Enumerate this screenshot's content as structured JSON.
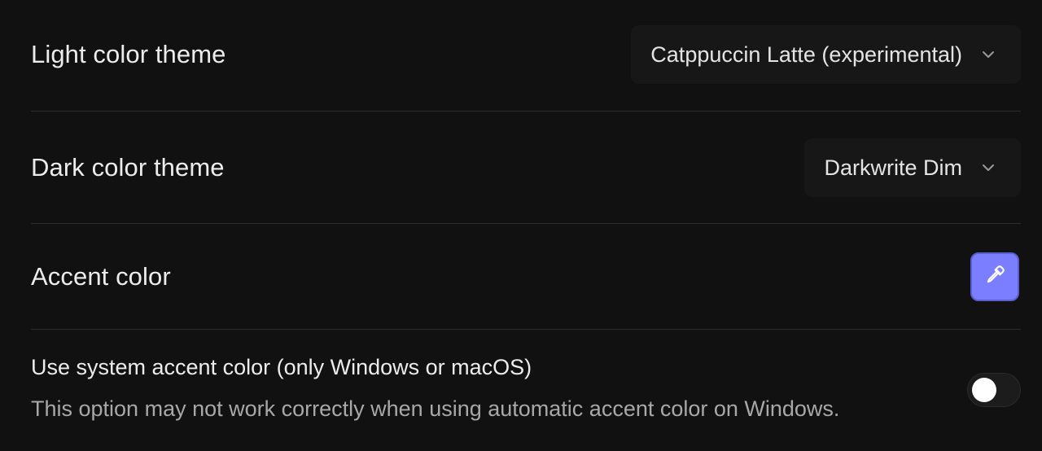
{
  "light_theme": {
    "label": "Light color theme",
    "selected": "Catppuccin Latte (experimental)"
  },
  "dark_theme": {
    "label": "Dark color theme",
    "selected": "Darkwrite Dim"
  },
  "accent": {
    "label": "Accent color",
    "color": "#7b7fff",
    "icon": "eyedropper-icon"
  },
  "system_accent": {
    "title": "Use system accent color (only Windows or macOS)",
    "description": "This option may not work correctly when using automatic accent color on Windows.",
    "enabled": false
  },
  "colors": {
    "background": "#111111",
    "divider": "#2c2c2c",
    "accent": "#7b7fff"
  }
}
